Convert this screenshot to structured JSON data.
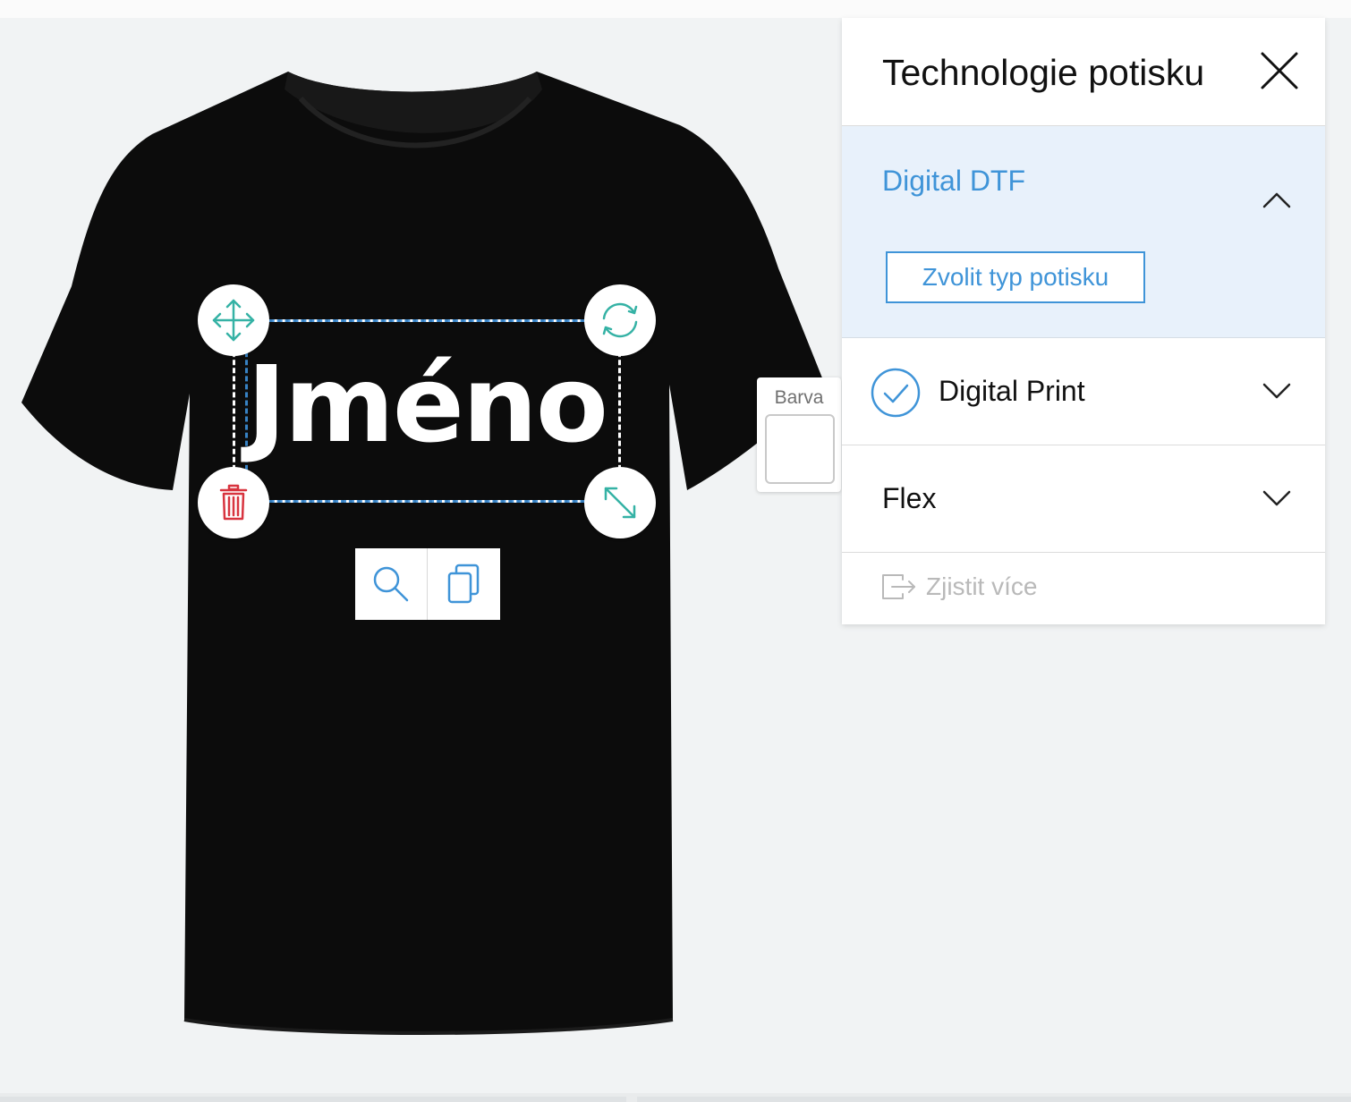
{
  "colors": {
    "accent": "#3f94d8",
    "teal": "#35b2a5",
    "danger": "#d8343f",
    "shirt": "#0c0c0c",
    "active_bg": "#e8f1fb"
  },
  "design": {
    "print_text": "Jméno",
    "handles": {
      "move": "move-arrows-icon",
      "rotate": "rotate-icon",
      "delete": "trash-icon",
      "resize": "resize-diagonal-icon"
    },
    "toolbar": [
      "zoom-icon",
      "duplicate-icon"
    ]
  },
  "color_picker": {
    "label": "Barva",
    "selected_color": "#ffffff"
  },
  "panel": {
    "title": "Technologie potisku",
    "close_icon": "close-icon",
    "options": [
      {
        "name": "Digital DTF",
        "expanded": true,
        "button_label": "Zvolit typ potisku"
      },
      {
        "name": "Digital Print",
        "expanded": false,
        "selected": true
      },
      {
        "name": "Flex",
        "expanded": false
      }
    ],
    "more_link": "Zjistit více",
    "more_icon": "exit-arrow-icon"
  }
}
